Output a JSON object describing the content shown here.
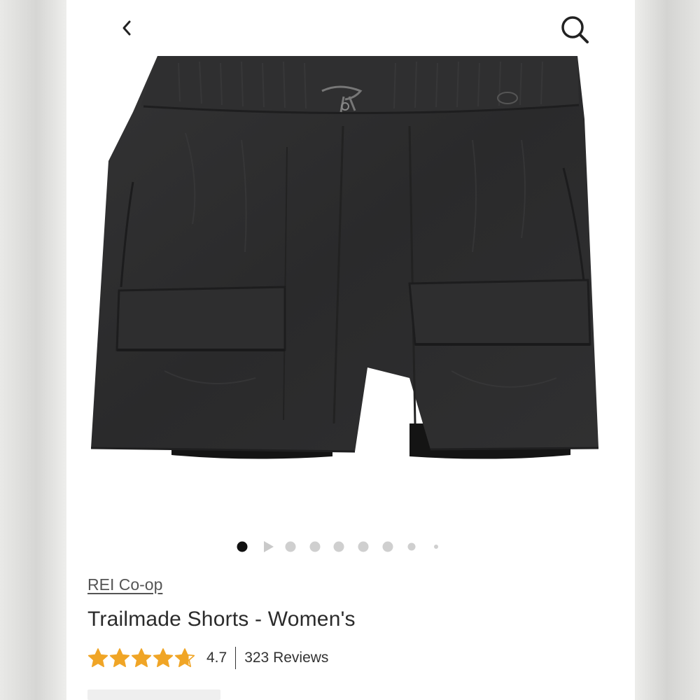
{
  "header": {
    "back_icon": "chevron-left-icon",
    "search_icon": "search-icon"
  },
  "carousel": {
    "dot_count": 9,
    "active_index": 0,
    "video_indicator_index": 1
  },
  "product": {
    "brand": "REI Co-op",
    "title": "Trailmade Shorts - Women's",
    "rating_value": "4.7",
    "rating": 4.7,
    "rating_max": 5,
    "reviews": "323 Reviews",
    "color": "#2a2a2b"
  },
  "colors": {
    "star": "#f0a526",
    "text": "#2b2b2b",
    "link": "#555555"
  }
}
